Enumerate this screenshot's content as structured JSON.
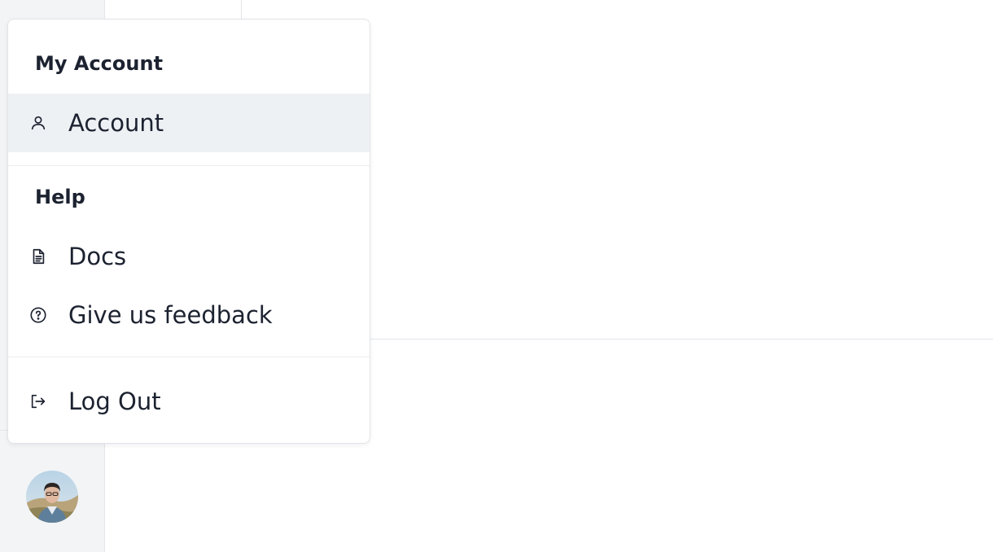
{
  "menu": {
    "account_section": {
      "heading": "My Account",
      "items": [
        {
          "label": "Account",
          "icon": "user-icon",
          "active": true
        }
      ]
    },
    "help_section": {
      "heading": "Help",
      "items": [
        {
          "label": "Docs",
          "icon": "document-icon"
        },
        {
          "label": "Give us feedback",
          "icon": "question-circle-icon"
        }
      ]
    },
    "footer_items": [
      {
        "label": "Log Out",
        "icon": "logout-icon"
      }
    ]
  },
  "user": {
    "avatar_icon": "user-avatar-photo"
  },
  "colors": {
    "active_row": "#edf1f4",
    "text": "#1c2230",
    "sidebar_bg": "#f3f4f6",
    "border": "#e2e4e8"
  }
}
